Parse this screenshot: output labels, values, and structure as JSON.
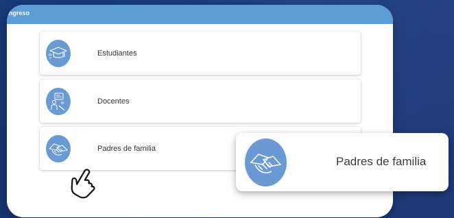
{
  "header": {
    "title": "Ingreso"
  },
  "roles": [
    {
      "label": "Estudiantes",
      "icon": "graduation-cap-icon"
    },
    {
      "label": "Docentes",
      "icon": "teacher-icon"
    },
    {
      "label": "Padres de familia",
      "icon": "handshake-icon"
    }
  ],
  "zoom_callout": {
    "label": "Padres de familia",
    "icon": "handshake-icon"
  },
  "colors": {
    "background": "#1f3f86",
    "header": "#5b9bd6",
    "icon_circle": "#6a9ad4",
    "card": "#ffffff"
  }
}
